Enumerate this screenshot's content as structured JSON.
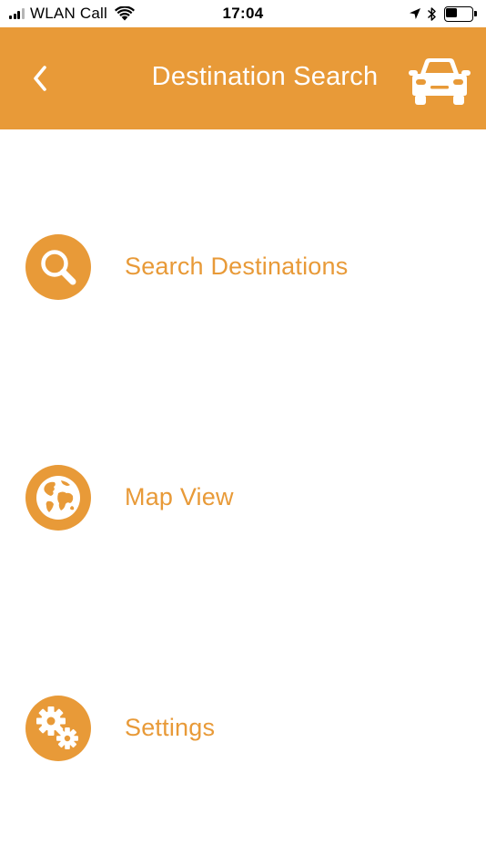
{
  "status_bar": {
    "carrier": "WLAN Call",
    "time": "17:04",
    "battery_level": 0.45
  },
  "header": {
    "title": "Destination Search",
    "back_icon": "chevron-left-icon",
    "right_icon": "car-icon"
  },
  "menu": {
    "items": [
      {
        "label": "Search Destinations",
        "icon": "magnifier-icon"
      },
      {
        "label": "Map View",
        "icon": "globe-icon"
      },
      {
        "label": "Settings",
        "icon": "gears-icon"
      }
    ]
  },
  "colors": {
    "accent": "#e89a38",
    "background": "#ffffff",
    "header_text": "#ffffff"
  }
}
